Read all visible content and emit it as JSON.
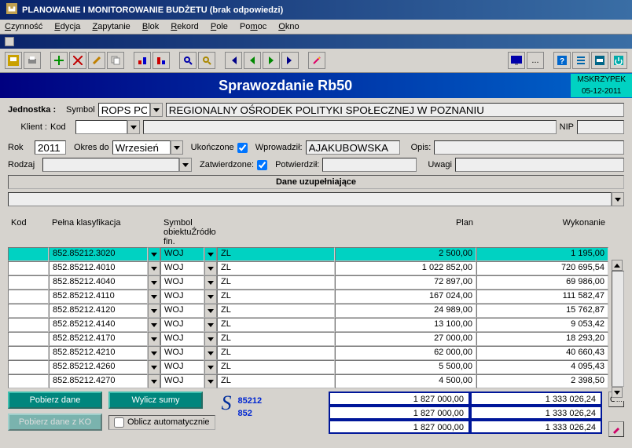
{
  "window": {
    "title": "PLANOWANIE I MONITOROWANIE BUDŻETU (brak odpowiedzi)"
  },
  "menu": {
    "czynnosc": "Czynność",
    "edycja": "Edycja",
    "zapytanie": "Zapytanie",
    "blok": "Blok",
    "rekord": "Rekord",
    "pole": "Pole",
    "pomoc": "Pomoc",
    "okno": "Okno"
  },
  "header": {
    "title": "Sprawozdanie Rb50",
    "user": "MSKRZYPEK",
    "date": "05-12-2011"
  },
  "form": {
    "jednostka_lbl": "Jednostka :",
    "symbol_lbl": "Symbol",
    "jednostka_symbol": "ROPS POZ",
    "jednostka_name": "REGIONALNY OŚRODEK POLITYKI SPOŁECZNEJ W POZNANIU",
    "klient_lbl": "Klient :",
    "kod_lbl": "Kod",
    "kod": "",
    "klient_name": "",
    "nip_lbl": "NIP",
    "nip": "",
    "rok_lbl": "Rok",
    "rok": "2011",
    "okres_lbl": "Okres do",
    "okres": "Wrzesień",
    "ukonczone_lbl": "Ukończone",
    "ukonczone": true,
    "wprowadzil_lbl": "Wprowadził:",
    "wprowadzil": "AJAKUBOWSKA",
    "opis_lbl": "Opis:",
    "opis": "",
    "rodzaj_lbl": "Rodzaj",
    "rodzaj": "",
    "zatwierdzone_lbl": "Zatwierdzone:",
    "zatwierdzone": true,
    "potwierdzil_lbl": "Potwierdził:",
    "potwierdzil": "",
    "uwagi_lbl": "Uwagi",
    "uwagi": ""
  },
  "section": {
    "dane": "Dane uzupełniające"
  },
  "grid": {
    "hdr_kod": "Kod",
    "hdr_klas": "Pełna klasyfikacja",
    "hdr_obj": "Symbol obiektu",
    "hdr_zrodlo": "Źródło fin.",
    "hdr_plan": "Plan",
    "hdr_wyk": "Wykonanie",
    "rows": [
      {
        "klas": "852.85212.3020",
        "obj": "WOJ",
        "zr": "ZL",
        "plan": "2 500,00",
        "wyk": "1 195,00",
        "hl": true
      },
      {
        "klas": "852.85212.4010",
        "obj": "WOJ",
        "zr": "ZL",
        "plan": "1 022 852,00",
        "wyk": "720 695,54"
      },
      {
        "klas": "852.85212.4040",
        "obj": "WOJ",
        "zr": "ZL",
        "plan": "72 897,00",
        "wyk": "69 986,00"
      },
      {
        "klas": "852.85212.4110",
        "obj": "WOJ",
        "zr": "ZL",
        "plan": "167 024,00",
        "wyk": "111 582,47"
      },
      {
        "klas": "852.85212.4120",
        "obj": "WOJ",
        "zr": "ZL",
        "plan": "24 989,00",
        "wyk": "15 762,87"
      },
      {
        "klas": "852.85212.4140",
        "obj": "WOJ",
        "zr": "ZL",
        "plan": "13 100,00",
        "wyk": "9 053,42"
      },
      {
        "klas": "852.85212.4170",
        "obj": "WOJ",
        "zr": "ZL",
        "plan": "27 000,00",
        "wyk": "18 293,20"
      },
      {
        "klas": "852.85212.4210",
        "obj": "WOJ",
        "zr": "ZL",
        "plan": "62 000,00",
        "wyk": "40 660,43"
      },
      {
        "klas": "852.85212.4260",
        "obj": "WOJ",
        "zr": "ZL",
        "plan": "5 500,00",
        "wyk": "4 095,43"
      },
      {
        "klas": "852.85212.4270",
        "obj": "WOJ",
        "zr": "ZL",
        "plan": "4 500,00",
        "wyk": "2 398,50"
      }
    ]
  },
  "footer": {
    "pobierz": "Pobierz dane",
    "wylicz": "Wylicz sumy",
    "pobierz_ko": "Pobierz dane z KO",
    "oblicz_auto": "Oblicz automatycznie",
    "sym": "S",
    "code1": "85212",
    "code2": "852",
    "totals": [
      {
        "plan": "1 827 000,00",
        "wyk": "1 333 026,24"
      },
      {
        "plan": "1 827 000,00",
        "wyk": "1 333 026,24"
      },
      {
        "plan": "1 827 000,00",
        "wyk": "1 333 026,24"
      }
    ],
    "btn_o": "O..."
  }
}
